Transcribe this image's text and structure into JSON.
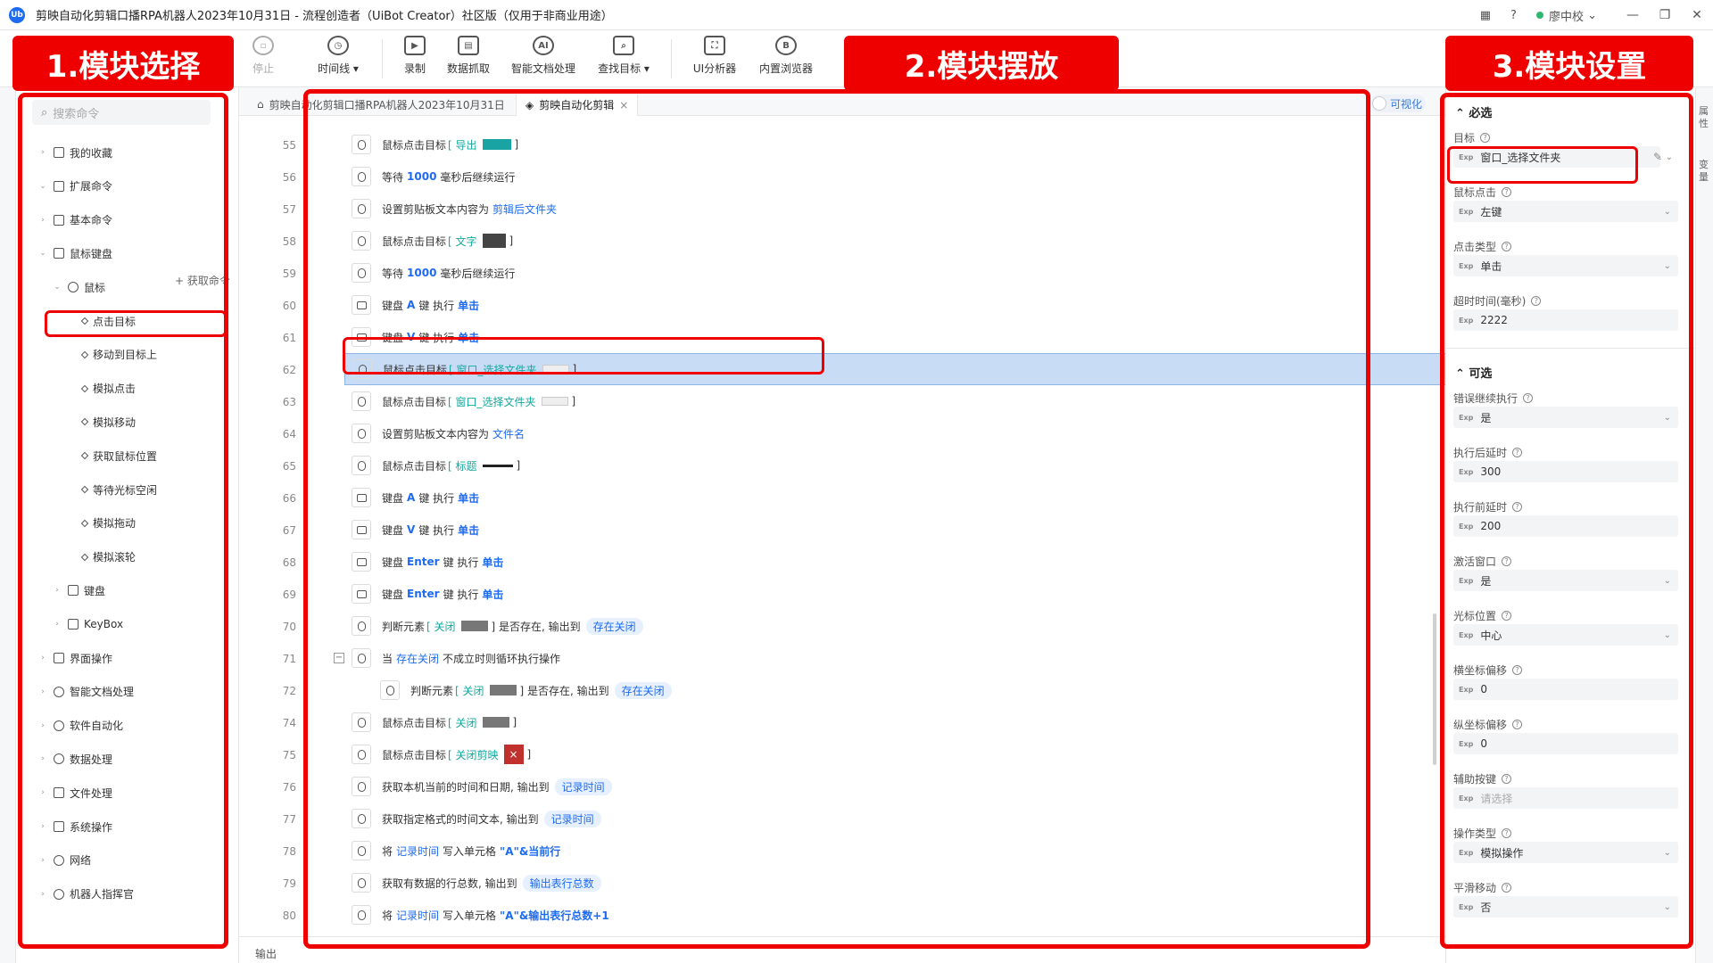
{
  "titlebar": {
    "title": "剪映自动化剪辑口播RPA机器人2023年10月31日 - 流程创造者（UiBot Creator）社区版（仅用于非商业用途）",
    "logo": "Ub",
    "user": "廖中校",
    "help": "?",
    "min": "—",
    "restore": "❐",
    "close": "✕"
  },
  "toolbar": {
    "stop": "停止",
    "timeline": "时间线",
    "record": "录制",
    "data_scrape": "数据抓取",
    "smart_doc": "智能文档处理",
    "find_target": "查找目标",
    "ui_analyzer": "UI分析器",
    "browser": "内置浏览器"
  },
  "left": {
    "search_placeholder": "搜索命令",
    "ext_add": "+ 获取命令",
    "items": [
      "我的收藏",
      "扩展命令",
      "基本命令",
      "鼠标键盘",
      "鼠标",
      "点击目标",
      "移动到目标上",
      "模拟点击",
      "模拟移动",
      "获取鼠标位置",
      "等待光标空闲",
      "模拟拖动",
      "模拟滚轮",
      "键盘",
      "KeyBox",
      "界面操作",
      "智能文档处理",
      "软件自动化",
      "数据处理",
      "文件处理",
      "系统操作",
      "网络",
      "机器人指挥官"
    ]
  },
  "center": {
    "tab1": "剪映自动化剪辑口播RPA机器人2023年10月31日",
    "tab2": "剪映自动化剪辑",
    "visual_toggle": "可视化",
    "output": "输出",
    "rows": [
      {
        "ln": "55",
        "pre": "鼠标点击目标",
        "kw": "[ 导出",
        "post": "]"
      },
      {
        "ln": "56",
        "pre": "等待",
        "kw": "1000",
        "post": "毫秒后继续运行"
      },
      {
        "ln": "57",
        "pre": "设置剪贴板文本内容为",
        "kw": "剪辑后文件夹",
        "post": ""
      },
      {
        "ln": "58",
        "pre": "鼠标点击目标",
        "kw": "[ 文字",
        "post": "]"
      },
      {
        "ln": "59",
        "pre": "等待",
        "kw": "1000",
        "post": "毫秒后继续运行"
      },
      {
        "ln": "60",
        "pre": "键盘",
        "kw": "A",
        "post": "键 执行",
        "tail": "单击"
      },
      {
        "ln": "61",
        "pre": "键盘",
        "kw": "V",
        "post": "键 执行",
        "tail": "单击"
      },
      {
        "ln": "62",
        "pre": "鼠标点击目标",
        "kw": "[ 窗口_选择文件夹",
        "post": "]"
      },
      {
        "ln": "63",
        "pre": "鼠标点击目标",
        "kw": "[ 窗口_选择文件夹",
        "post": "]"
      },
      {
        "ln": "64",
        "pre": "设置剪贴板文本内容为",
        "kw": "文件名",
        "post": ""
      },
      {
        "ln": "65",
        "pre": "鼠标点击目标",
        "kw": "[ 标题",
        "post": "]"
      },
      {
        "ln": "66",
        "pre": "键盘",
        "kw": "A",
        "post": "键 执行",
        "tail": "单击"
      },
      {
        "ln": "67",
        "pre": "键盘",
        "kw": "V",
        "post": "键 执行",
        "tail": "单击"
      },
      {
        "ln": "68",
        "pre": "键盘",
        "kw": "Enter",
        "post": "键 执行",
        "tail": "单击"
      },
      {
        "ln": "69",
        "pre": "键盘",
        "kw": "Enter",
        "post": "键 执行",
        "tail": "单击"
      },
      {
        "ln": "70",
        "pre": "判断元素",
        "kw": "[ 关闭",
        "post": "] 是否存在, 输出到",
        "tail": "存在关闭"
      },
      {
        "ln": "71",
        "pre": "当",
        "kw": "存在关闭",
        "post": "不成立时则循环执行操作"
      },
      {
        "ln": "72",
        "pre": "判断元素",
        "kw": "[ 关闭",
        "post": "] 是否存在, 输出到",
        "tail": "存在关闭"
      },
      {
        "ln": "74",
        "pre": "鼠标点击目标",
        "kw": "[ 关闭",
        "post": "]"
      },
      {
        "ln": "75",
        "pre": "鼠标点击目标",
        "kw": "[ 关闭剪映",
        "post": "]"
      },
      {
        "ln": "76",
        "pre": "获取本机当前的时间和日期, 输出到",
        "kw": "",
        "post": "",
        "tail": "记录时间"
      },
      {
        "ln": "77",
        "pre": "获取指定格式的时间文本, 输出到",
        "kw": "",
        "post": "",
        "tail": "记录时间"
      },
      {
        "ln": "78",
        "pre": "将",
        "kw": "记录时间",
        "post": "写入单元格",
        "tail2": "\"A\"&当前行"
      },
      {
        "ln": "79",
        "pre": "获取有数据的行总数, 输出到",
        "kw": "",
        "post": "",
        "tail": "输出表行总数"
      },
      {
        "ln": "80",
        "pre": "将",
        "kw": "记录时间",
        "post": "写入单元格",
        "tail2": "\"A\"&输出表行总数+1"
      }
    ]
  },
  "right": {
    "required": "必选",
    "optional": "可选",
    "exp": "Exp",
    "fields_required": [
      {
        "label": "目标",
        "value": "窗口_选择文件夹"
      },
      {
        "label": "鼠标点击",
        "value": "左键"
      },
      {
        "label": "点击类型",
        "value": "单击"
      },
      {
        "label": "超时时间(毫秒)",
        "value": "2222"
      }
    ],
    "fields_optional": [
      {
        "label": "错误继续执行",
        "value": "是"
      },
      {
        "label": "执行后延时",
        "value": "300"
      },
      {
        "label": "执行前延时",
        "value": "200"
      },
      {
        "label": "激活窗口",
        "value": "是"
      },
      {
        "label": "光标位置",
        "value": "中心"
      },
      {
        "label": "横坐标偏移",
        "value": "0"
      },
      {
        "label": "纵坐标偏移",
        "value": "0"
      },
      {
        "label": "辅助按键",
        "value": "请选择"
      },
      {
        "label": "操作类型",
        "value": "模拟操作"
      },
      {
        "label": "平滑移动",
        "value": "否"
      }
    ],
    "edge_right": "属性",
    "edge_right2": "变量"
  },
  "annotations": {
    "label1": "1.模块选择",
    "label2": "2.模块摆放",
    "label3": "3.模块设置"
  },
  "colors": {
    "accent": "#1d6bf3",
    "annotation": "#ee0000",
    "selected_row": "#c9dcf6"
  }
}
